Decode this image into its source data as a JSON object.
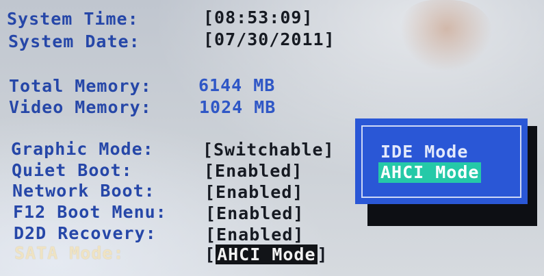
{
  "system_time": {
    "label": "System Time:",
    "value": "[08:53:09]"
  },
  "system_date": {
    "label": "System Date:",
    "value": "[07/30/2011]"
  },
  "total_memory": {
    "label": "Total Memory:",
    "value": "6144 MB"
  },
  "video_memory": {
    "label": "Video Memory:",
    "value": "1024 MB"
  },
  "settings": [
    {
      "label": "Graphic Mode:",
      "value": "[Switchable]"
    },
    {
      "label": "Quiet Boot:",
      "value": "[Enabled]"
    },
    {
      "label": "Network Boot:",
      "value": "[Enabled]"
    },
    {
      "label": "F12 Boot Menu:",
      "value": "[Enabled]"
    },
    {
      "label": "D2D Recovery:",
      "value": "[Enabled]"
    }
  ],
  "sata_mode": {
    "label": "SATA Mode:",
    "bracket_open": "[",
    "value": "AHCI Mode",
    "bracket_close": "]",
    "selected": true
  },
  "sata_popup": {
    "options": [
      "IDE Mode",
      "AHCI Mode"
    ],
    "selected_option": "AHCI Mode"
  },
  "colors": {
    "label": "#2647a8",
    "value": "#161a22",
    "value_blue": "#2f57c6",
    "selected_label": "#efe3c3",
    "popup_bg": "#2a57d6",
    "popup_highlight": "#25c9a8"
  }
}
